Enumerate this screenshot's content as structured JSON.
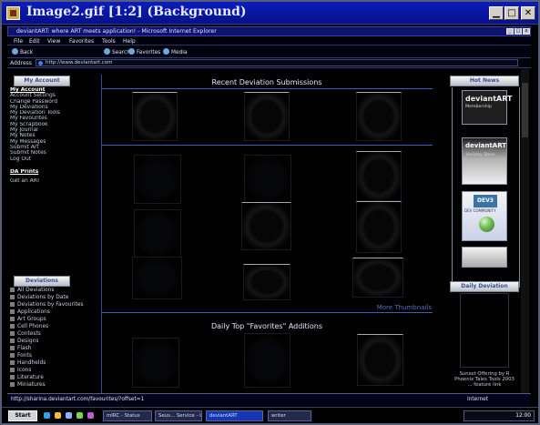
{
  "outer_window": {
    "title": "Image2.gif [1:2] (Background)",
    "minimize": "▁",
    "maximize": "□",
    "close": "✕"
  },
  "browser_window": {
    "title": "deviantART: where ART meets application! - Microsoft Internet Explorer",
    "minimize": "_",
    "maximize": "□",
    "close": "x"
  },
  "menu": [
    "File",
    "Edit",
    "View",
    "Favorites",
    "Tools",
    "Help"
  ],
  "toolbar": {
    "back": "Back",
    "search": "Search",
    "favorites": "Favorites",
    "media": "Media"
  },
  "address": {
    "label": "Address",
    "url": "http://www.deviantart.com"
  },
  "left": {
    "account_header": "My Account",
    "account_links": [
      "My Account",
      "Account Settings",
      "Change Password",
      "My Deviations",
      "My Deviation Tools",
      "My Favourites",
      "My Scrapbook",
      "My Journal",
      "My Notes",
      "My Messages",
      "Submit Art",
      "Submit Notes",
      "Log Out"
    ],
    "prints_label": "DA Prints",
    "prints_sub": "Get an ART",
    "deviations_header": "Deviations",
    "categories": [
      "All Deviations",
      "Deviations by Date",
      "Deviations by Favourites",
      "Applications",
      "Art Groups",
      "Cell Phones",
      "Contests",
      "Designs",
      "Flash",
      "Fonts",
      "Handhelds",
      "Icons",
      "Literature",
      "Miniatures"
    ]
  },
  "main": {
    "recent_title": "Recent Deviation Submissions",
    "more_thumbnails": "More Thumbnails",
    "favorites_title": "Daily Top \"Favorites\" Additions"
  },
  "right": {
    "hot_header": "Hot News",
    "promo_membership_title": "deviantART",
    "promo_membership_sub": "Membership",
    "promo_holiday_title": "deviantART",
    "promo_holiday_sub": "Holiday Store",
    "promo_dev3": "DEV3",
    "promo_dev3_sub": "DEV COMMUNITY",
    "daily_header": "Daily Deviation",
    "daily_caption": "Sunset Offering by R Phoenix Tales Tools 2003 ... feature link"
  },
  "status": {
    "url": "http://sharina.deviantart.com/favourites/?offset=1",
    "zone": "Internet"
  },
  "taskbar": {
    "start": "Start",
    "tasks": [
      "mIRC - Status",
      "Seus... Service - U.",
      "deviantART",
      "writer"
    ],
    "time": "12:00"
  }
}
